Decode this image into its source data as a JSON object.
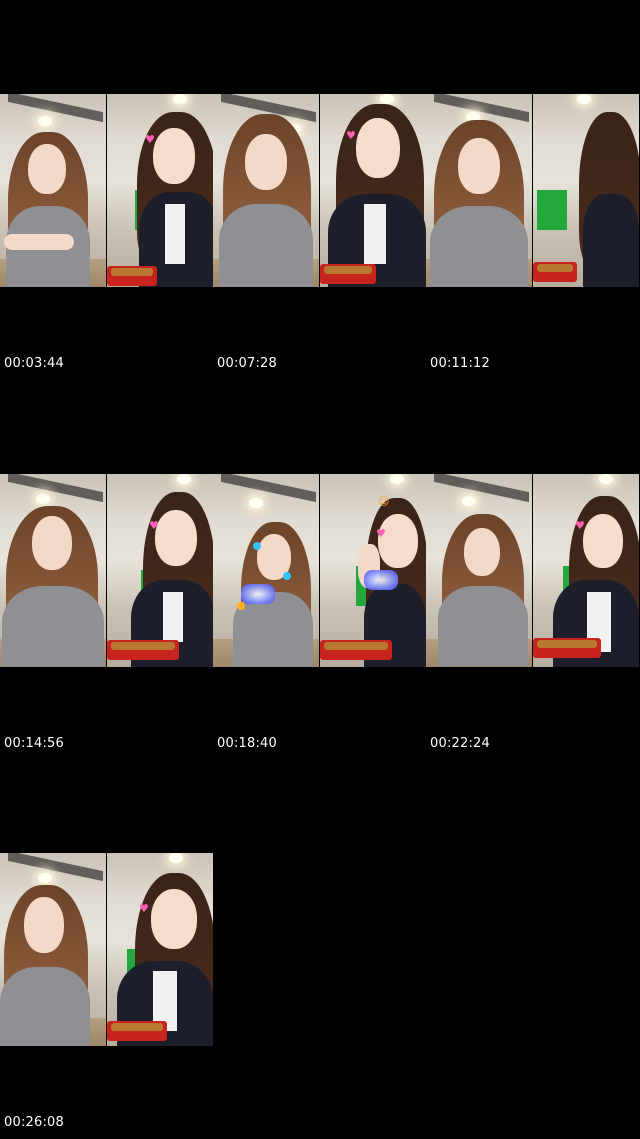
{
  "thumbnails": [
    {
      "timestamp": "00:03:44"
    },
    {
      "timestamp": "00:07:28"
    },
    {
      "timestamp": "00:11:12"
    },
    {
      "timestamp": "00:14:56"
    },
    {
      "timestamp": "00:18:40"
    },
    {
      "timestamp": "00:22:24"
    },
    {
      "timestamp": "00:26:08"
    }
  ]
}
